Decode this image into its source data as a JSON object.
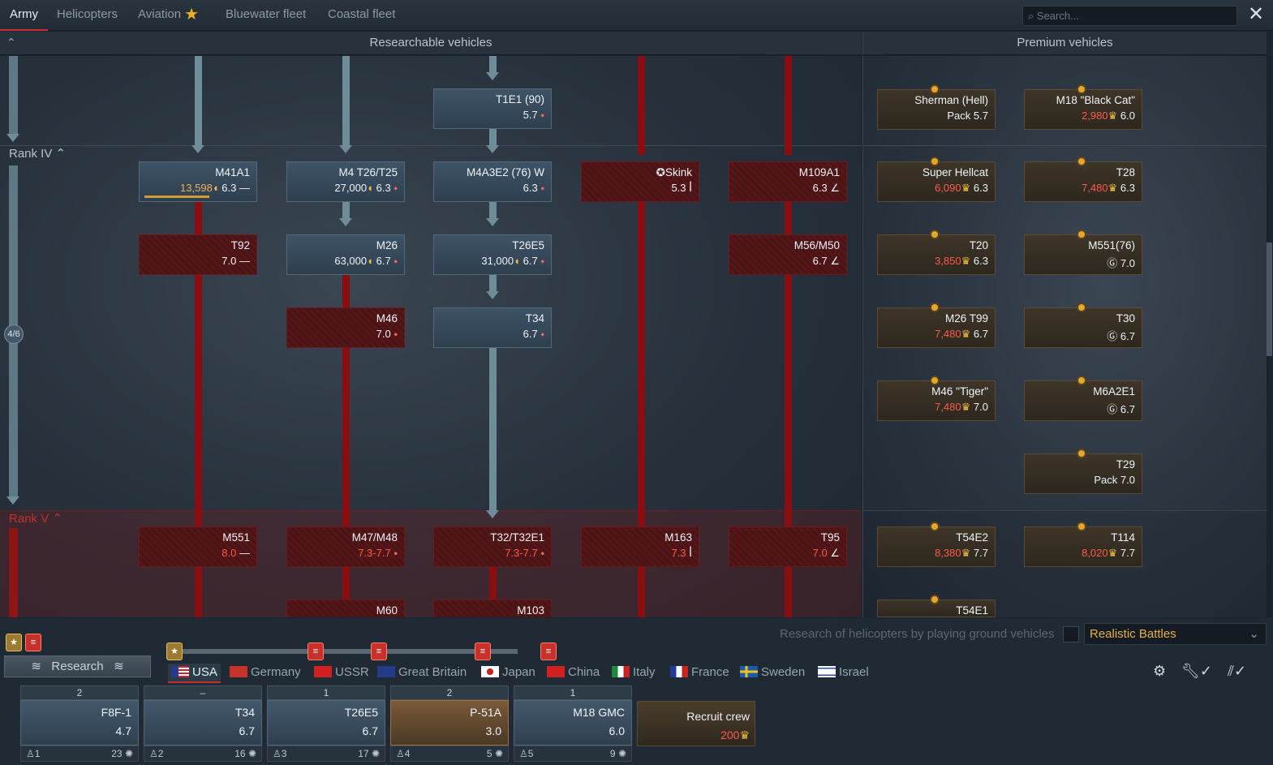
{
  "tabs": [
    {
      "label": "Army",
      "active": true
    },
    {
      "label": "Helicopters"
    },
    {
      "label": "Aviation",
      "star": true
    },
    {
      "label": "Bluewater fleet"
    },
    {
      "label": "Coastal fleet"
    }
  ],
  "search": {
    "placeholder": "Search..."
  },
  "headers": {
    "researchable": "Researchable vehicles",
    "premium": "Premium vehicles"
  },
  "ranks": {
    "r4": "Rank IV",
    "r5": "Rank V",
    "count": "4/6"
  },
  "icons": {
    "star": "star-icon",
    "search": "search-icon",
    "close": "close-icon",
    "gear": "gear-icon",
    "wrench": "wrench-icon"
  },
  "colors": {
    "locked": "#8a0d10",
    "researched_line": "#6f8c99",
    "accent": "#c8302f",
    "price": "#ff5a4a",
    "mode": "#e6b04a"
  },
  "tree": [
    {
      "id": "t1e1",
      "name": "T1E1 (90)",
      "stats": "5.7",
      "status": "owned"
    },
    {
      "id": "m41a1",
      "name": "M41A1",
      "cost": "13,598",
      "stats": "6.3",
      "status": "researching",
      "progress": 0.6
    },
    {
      "id": "m4t26",
      "name": "M4 T26/T25",
      "cost": "27,000",
      "stats": "6.3",
      "status": "available"
    },
    {
      "id": "m4a3e2",
      "name": "M4A3E2 (76) W",
      "stats": "6.3",
      "status": "owned"
    },
    {
      "id": "skink",
      "name": "✪Skink",
      "stats": "5.3",
      "status": "locked"
    },
    {
      "id": "m109a1",
      "name": "M109A1",
      "stats": "6.3",
      "status": "locked"
    },
    {
      "id": "t92",
      "name": "T92",
      "stats": "7.0",
      "status": "locked"
    },
    {
      "id": "m26",
      "name": "M26",
      "cost": "63,000",
      "stats": "6.7",
      "status": "available"
    },
    {
      "id": "t26e5",
      "name": "T26E5",
      "cost": "31,000",
      "stats": "6.7",
      "status": "available"
    },
    {
      "id": "m56",
      "name": "M56/M50",
      "stats": "6.7",
      "status": "locked"
    },
    {
      "id": "m46",
      "name": "M46",
      "stats": "7.0",
      "status": "locked"
    },
    {
      "id": "t34",
      "name": "T34",
      "stats": "6.7",
      "status": "owned"
    },
    {
      "id": "m551",
      "name": "M551",
      "stats": "8.0",
      "status": "locked"
    },
    {
      "id": "m47",
      "name": "M47/M48",
      "stats": "7.3-7.7",
      "status": "locked"
    },
    {
      "id": "t32",
      "name": "T32/T32E1",
      "stats": "7.3-7.7",
      "status": "locked"
    },
    {
      "id": "m163",
      "name": "M163",
      "stats": "7.3",
      "status": "locked"
    },
    {
      "id": "t95",
      "name": "T95",
      "stats": "7.0",
      "status": "locked"
    },
    {
      "id": "m60",
      "name": "M60",
      "stats": "",
      "status": "locked"
    },
    {
      "id": "m103",
      "name": "M103",
      "stats": "",
      "status": "locked"
    }
  ],
  "premium": [
    {
      "id": "sherman_hell",
      "name": "Sherman (Hell)",
      "cost": "Pack",
      "stats": "5.7"
    },
    {
      "id": "m18bc",
      "name": "M18 \"Black Cat\"",
      "cost": "2,980",
      "stats": "6.0"
    },
    {
      "id": "superhellcat",
      "name": "Super Hellcat",
      "cost": "6,090",
      "stats": "6.3"
    },
    {
      "id": "t28",
      "name": "T28",
      "cost": "7,480",
      "stats": "6.3"
    },
    {
      "id": "t20",
      "name": "T20",
      "cost": "3,850",
      "stats": "6.3"
    },
    {
      "id": "m551_76",
      "name": "M551(76)",
      "cost": "Ⓖ",
      "stats": "7.0"
    },
    {
      "id": "m26t99",
      "name": "M26 T99",
      "cost": "7,480",
      "stats": "6.7"
    },
    {
      "id": "t30",
      "name": "T30",
      "cost": "Ⓖ",
      "stats": "6.7"
    },
    {
      "id": "m46tiger",
      "name": "M46 \"Tiger\"",
      "cost": "7,480",
      "stats": "7.0"
    },
    {
      "id": "m6a2e1",
      "name": "M6A2E1",
      "cost": "Ⓖ",
      "stats": "6.7"
    },
    {
      "id": "t29",
      "name": "T29",
      "cost": "Pack",
      "stats": "7.0"
    },
    {
      "id": "t54e2",
      "name": "T54E2",
      "cost": "8,380",
      "stats": "7.7"
    },
    {
      "id": "t114",
      "name": "T114",
      "cost": "8,020",
      "stats": "7.7"
    },
    {
      "id": "t54e1",
      "name": "T54E1",
      "cost": "",
      "stats": ""
    }
  ],
  "mode_note": "Research of helicopters by playing ground vehicles",
  "mode": "Realistic Battles",
  "research_label": "Research",
  "nations": [
    "USA",
    "Germany",
    "USSR",
    "Great Britain",
    "Japan",
    "China",
    "Italy",
    "France",
    "Sweden",
    "Israel"
  ],
  "slots": [
    {
      "top": "2",
      "name": "F8F-1",
      "br": "4.7",
      "num": "1",
      "crew": "23",
      "type": "air"
    },
    {
      "top": "–",
      "name": "T34",
      "br": "6.7",
      "num": "2",
      "crew": "16",
      "type": "ground"
    },
    {
      "top": "1",
      "name": "T26E5",
      "br": "6.7",
      "num": "3",
      "crew": "17",
      "type": "ground"
    },
    {
      "top": "2",
      "name": "P-51A",
      "br": "3.0",
      "num": "4",
      "crew": "5",
      "type": "air-prem"
    },
    {
      "top": "1",
      "name": "M18 GMC",
      "br": "6.0",
      "num": "5",
      "crew": "9",
      "type": "ground"
    }
  ],
  "recruit": {
    "label": "Recruit crew",
    "cost": "200"
  }
}
